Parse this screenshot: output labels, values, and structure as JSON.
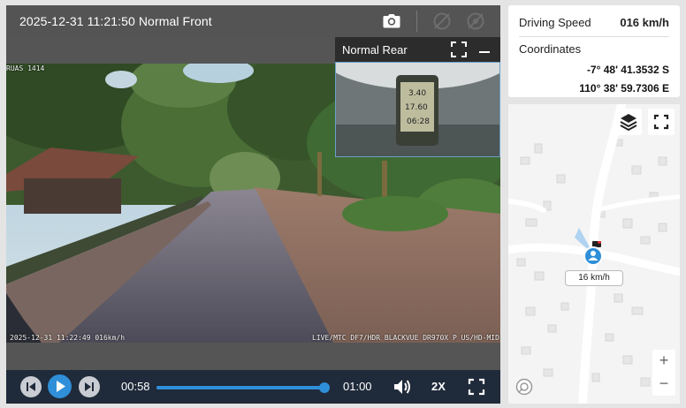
{
  "player": {
    "title": "2025-12-31 11:21:50 Normal Front",
    "front_osd_top": "RUAS 1414",
    "front_osd_timestamp": "2025-12-31 11:22:49 016km/h",
    "front_osd_right": "LIVE/MTC DF7/HDR BLACKVUE DR970X P US/HD-MID",
    "rear_label": "Normal Rear",
    "rear_device_lines": [
      "3.40",
      "17.60",
      "06:28"
    ]
  },
  "controls": {
    "current_time": "00:58",
    "total_time": "01:00",
    "progress": 0.967,
    "playback_speed": "2X"
  },
  "info": {
    "speed_label": "Driving Speed",
    "speed_value": "016 km/h",
    "coordinates_label": "Coordinates",
    "latitude": "-7° 48' 41.3532 S",
    "longitude": "110° 38' 59.7306 E"
  },
  "map": {
    "speed_tag": "16 km/h",
    "zoom_in": "+",
    "zoom_out": "−"
  },
  "colors": {
    "accent": "#2f8fd8",
    "control_bar": "#1f2a3a",
    "top_bar": "#545454",
    "marker": "#2f8fd8"
  }
}
